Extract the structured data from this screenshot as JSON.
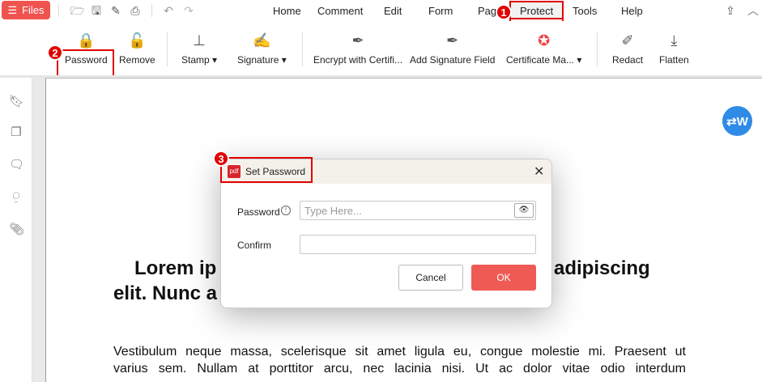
{
  "topbar": {
    "files_label": "Files",
    "menu": [
      "Home",
      "Comment",
      "Edit",
      "Form",
      "Page",
      "Protect",
      "Tools",
      "Help"
    ]
  },
  "ribbon": {
    "items": [
      {
        "label": "Password"
      },
      {
        "label": "Remove"
      },
      {
        "label": "Stamp ▾"
      },
      {
        "label": "Signature ▾"
      },
      {
        "label": "Encrypt with Certifi..."
      },
      {
        "label": "Add Signature Field"
      },
      {
        "label": "Certificate Ma... ▾"
      },
      {
        "label": "Redact"
      },
      {
        "label": "Flatten"
      }
    ]
  },
  "document": {
    "heading_line1_left": "Lorem ip",
    "heading_line1_right": "adipiscing",
    "heading_line2": "elit. Nunc a",
    "para_line1": "Vestibulum neque massa, scelerisque sit amet ligula eu, congue molestie mi. Praesent ut",
    "para_line2": "varius sem. Nullam at porttitor arcu, nec lacinia nisi. Ut ac dolor vitae odio interdum"
  },
  "dialog": {
    "title": "Set Password",
    "password_label": "Password",
    "password_placeholder": "Type Here...",
    "confirm_label": "Confirm",
    "cancel_label": "Cancel",
    "ok_label": "OK"
  },
  "annotations": {
    "step1": "1",
    "step2": "2",
    "step3": "3"
  },
  "colors": {
    "accent": "#ef5350",
    "highlight": "#e00000",
    "fab": "#2f8be6"
  }
}
